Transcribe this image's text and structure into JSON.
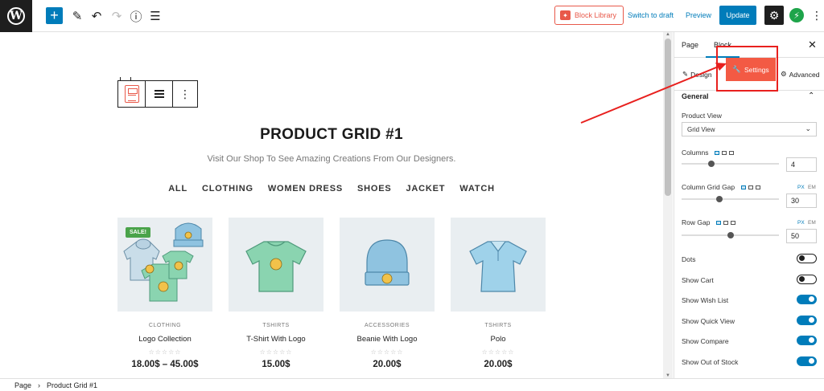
{
  "topbar": {
    "block_library_label": "Block Library",
    "switch_to_draft_label": "Switch to draft",
    "preview_label": "Preview",
    "update_label": "Update"
  },
  "canvas": {
    "title": "PRODUCT GRID #1",
    "subtitle": "Visit Our Shop To See Amazing Creations From Our Designers.",
    "filters": [
      "ALL",
      "CLOTHING",
      "WOMEN DRESS",
      "SHOES",
      "JACKET",
      "WATCH"
    ],
    "products": [
      {
        "category": "CLOTHING",
        "name": "Logo Collection",
        "price": "18.00$ – 45.00$",
        "badge": "SALE!",
        "rating_stars": "☆☆☆☆☆"
      },
      {
        "category": "TSHIRTS",
        "name": "T-Shirt With Logo",
        "price": "15.00$",
        "badge": "",
        "rating_stars": "☆☆☆☆☆"
      },
      {
        "category": "ACCESSORIES",
        "name": "Beanie With Logo",
        "price": "20.00$",
        "badge": "",
        "rating_stars": "☆☆☆☆☆"
      },
      {
        "category": "TSHIRTS",
        "name": "Polo",
        "price": "20.00$",
        "badge": "",
        "rating_stars": "☆☆☆☆☆"
      }
    ]
  },
  "breadcrumb": {
    "root": "Page",
    "separator": "›",
    "current": "Product Grid #1"
  },
  "sidebar": {
    "tabs": [
      "Page",
      "Block"
    ],
    "active_tab": "Block",
    "subtabs": {
      "design": "Design",
      "settings": "Settings",
      "advanced": "Advanced"
    },
    "active_subtab": "Settings",
    "section_title": "General",
    "product_view": {
      "label": "Product View",
      "value": "Grid View"
    },
    "columns": {
      "label": "Columns",
      "value": "4",
      "slider_level": 0.29
    },
    "column_gap": {
      "label": "Column Grid Gap",
      "value": "30",
      "unit_px": "PX",
      "unit_em": "EM",
      "slider_level": 0.38
    },
    "row_gap": {
      "label": "Row Gap",
      "value": "50",
      "unit_px": "PX",
      "unit_em": "EM",
      "slider_level": 0.5
    },
    "toggles": [
      {
        "label": "Dots",
        "on": false
      },
      {
        "label": "Show Cart",
        "on": false
      },
      {
        "label": "Show Wish List",
        "on": true
      },
      {
        "label": "Show Quick View",
        "on": true
      },
      {
        "label": "Show Compare",
        "on": true
      },
      {
        "label": "Show Out of Stock",
        "on": true
      }
    ]
  },
  "colors": {
    "accent": "#007cba",
    "settings_button": "#f35a44",
    "annotation": "#e8201e",
    "sale_badge": "#4aa34a"
  }
}
